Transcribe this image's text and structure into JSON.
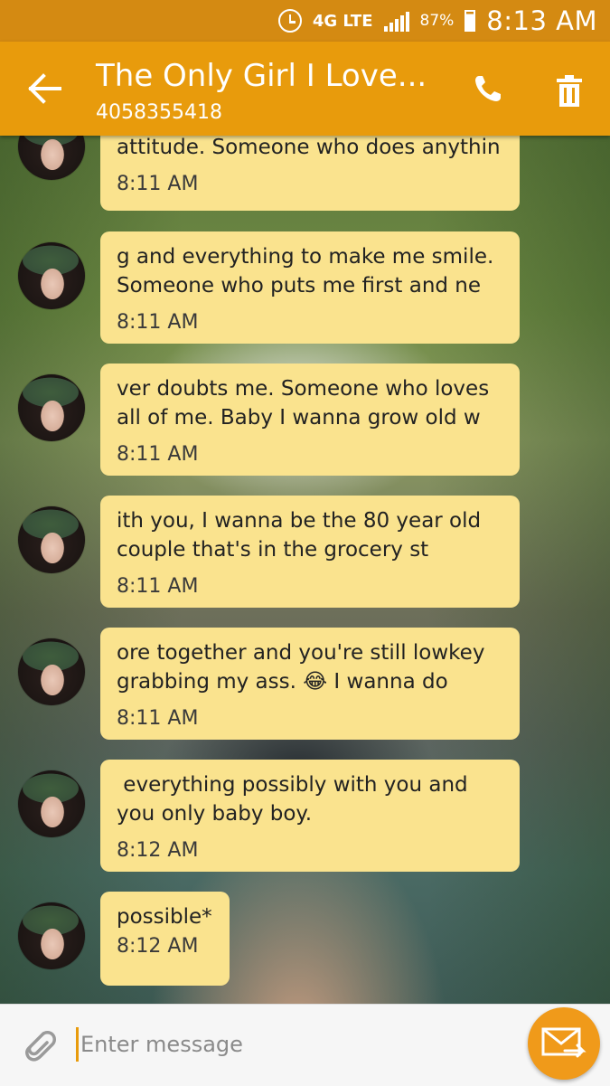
{
  "status_bar": {
    "network": "4G LTE",
    "battery": "87%",
    "time": "8:13 AM",
    "icons": [
      "alarm-icon",
      "signal-icon",
      "battery-icon"
    ]
  },
  "app_bar": {
    "contact_name": "The Only Girl I Love...",
    "contact_number": "4058355418",
    "icons": [
      "back-arrow-icon",
      "phone-icon",
      "trash-icon"
    ]
  },
  "messages": [
    {
      "text": "attitude. Someone who does anythin",
      "time": "8:11 AM"
    },
    {
      "text": "g and everything to make me smile.\nSomeone who puts me first and ne",
      "time": "8:11 AM"
    },
    {
      "text": "ver doubts me. Someone who loves\nall of me. Baby I wanna grow old w",
      "time": "8:11 AM"
    },
    {
      "text": "ith you, I wanna be the 80 year old\ncouple that's in the grocery st",
      "time": "8:11 AM"
    },
    {
      "text": "ore together and you're still lowkey\ngrabbing my ass. 😂 I wanna do",
      "time": "8:11 AM"
    },
    {
      "text": " everything possibly with you and\nyou only baby boy.",
      "time": "8:12 AM"
    },
    {
      "text": "possible*",
      "time": "8:12 AM"
    }
  ],
  "composer": {
    "placeholder": "Enter message",
    "icons": [
      "paperclip-icon",
      "send-mail-icon"
    ]
  },
  "colors": {
    "status_bar": "#d48a12",
    "app_bar": "#e89b0c",
    "bubble": "#fae38e",
    "send_button": "#f09a1a"
  }
}
